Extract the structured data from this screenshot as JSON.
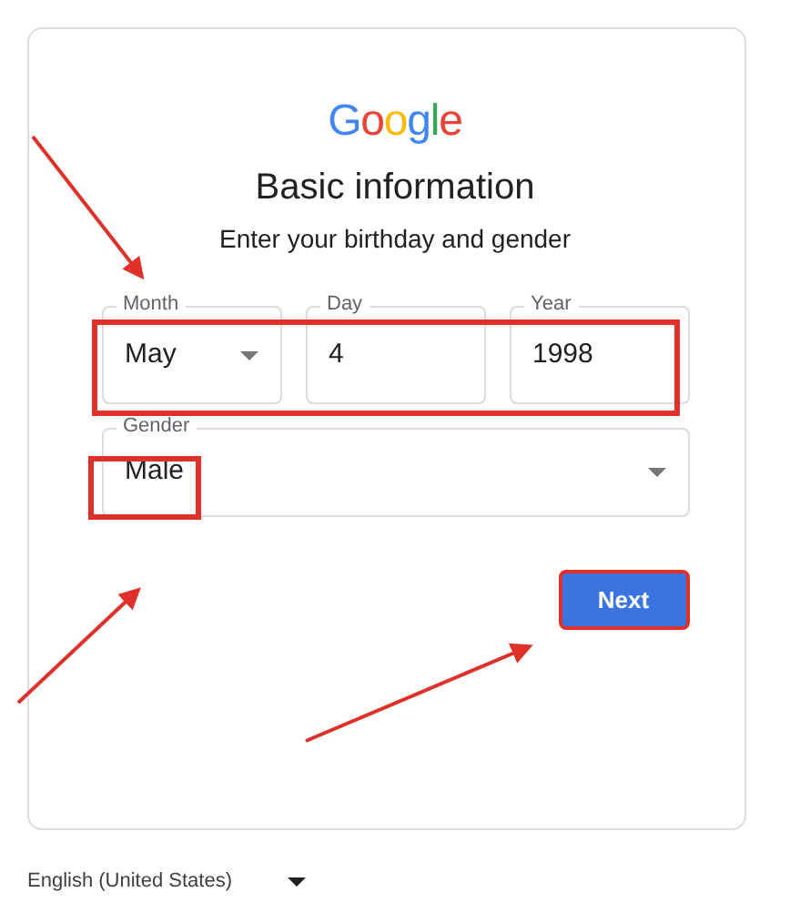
{
  "logo": "Google",
  "title": "Basic information",
  "subtitle": "Enter your birthday and gender",
  "date_fields": [
    {
      "label": "Month",
      "value": "May",
      "kind": "select"
    },
    {
      "label": "Day",
      "value": "4",
      "kind": "input"
    },
    {
      "label": "Year",
      "value": "1998",
      "kind": "input"
    }
  ],
  "gender": {
    "label": "Gender",
    "value": "Male"
  },
  "next_button": "Next",
  "footer": {
    "language": "English (United States)"
  }
}
